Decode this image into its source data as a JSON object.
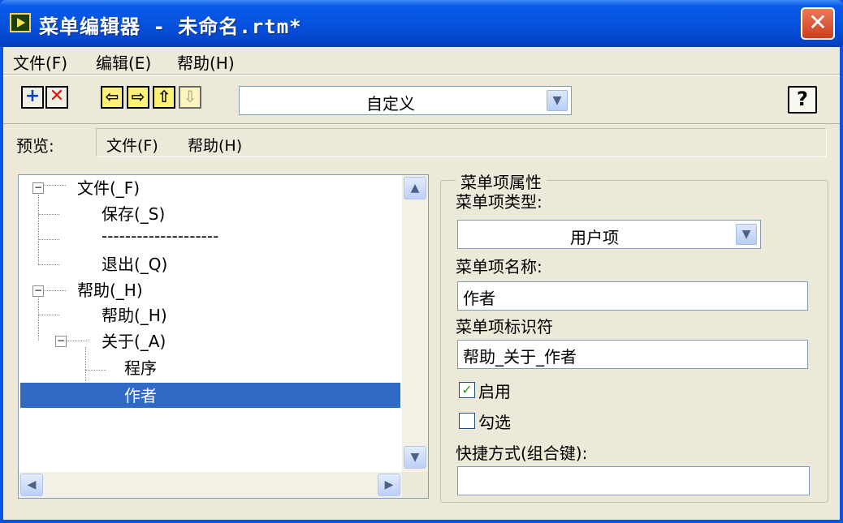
{
  "window": {
    "title": "菜单编辑器 - 未命名.rtm*",
    "close_glyph": "✕"
  },
  "menubar": {
    "items": [
      {
        "label": "文件(F)"
      },
      {
        "label": "编辑(E)"
      },
      {
        "label": "帮助(H)"
      }
    ]
  },
  "toolbar": {
    "add_glyph": "+",
    "delete_glyph": "✕",
    "left_glyph": "⇦",
    "right_glyph": "⇨",
    "up_glyph": "⇧",
    "down_glyph": "⇩",
    "menu_type_value": "自定义",
    "dropdown_glyph": "▼",
    "help_glyph": "?"
  },
  "preview": {
    "label": "预览:",
    "items": [
      {
        "label": "文件(F)"
      },
      {
        "label": "帮助(H)"
      }
    ]
  },
  "tree": {
    "items": [
      {
        "label": "文件(_F)",
        "level": 0,
        "expanded": true
      },
      {
        "label": "保存(_S)",
        "level": 1
      },
      {
        "label": "--------------------",
        "level": 1
      },
      {
        "label": "退出(_Q)",
        "level": 1
      },
      {
        "label": "帮助(_H)",
        "level": 0,
        "expanded": true
      },
      {
        "label": "帮助(_H)",
        "level": 1
      },
      {
        "label": "关于(_A)",
        "level": 1,
        "expanded": true
      },
      {
        "label": "程序",
        "level": 2
      },
      {
        "label": "作者",
        "level": 2,
        "selected": true
      }
    ],
    "expander_glyph": "−",
    "scroll_up_glyph": "▲",
    "scroll_down_glyph": "▼",
    "scroll_left_glyph": "◀",
    "scroll_right_glyph": "▶"
  },
  "properties": {
    "group_title": "菜单项属性",
    "type_label": "菜单项类型:",
    "type_value": "用户项",
    "name_label": "菜单项名称:",
    "name_value": "作者",
    "id_label": "菜单项标识符",
    "id_value": "帮助_关于_作者",
    "enabled_label": "启用",
    "enabled_checked": true,
    "enabled_check_glyph": "✓",
    "checked_label": "勾选",
    "checked_checked": false,
    "shortcut_label": "快捷方式(组合键):",
    "shortcut_value": ""
  },
  "colors": {
    "titlebar": "#0552df",
    "selection": "#316ac5",
    "close_button": "#c9401e",
    "arrow_button": "#fff277"
  }
}
